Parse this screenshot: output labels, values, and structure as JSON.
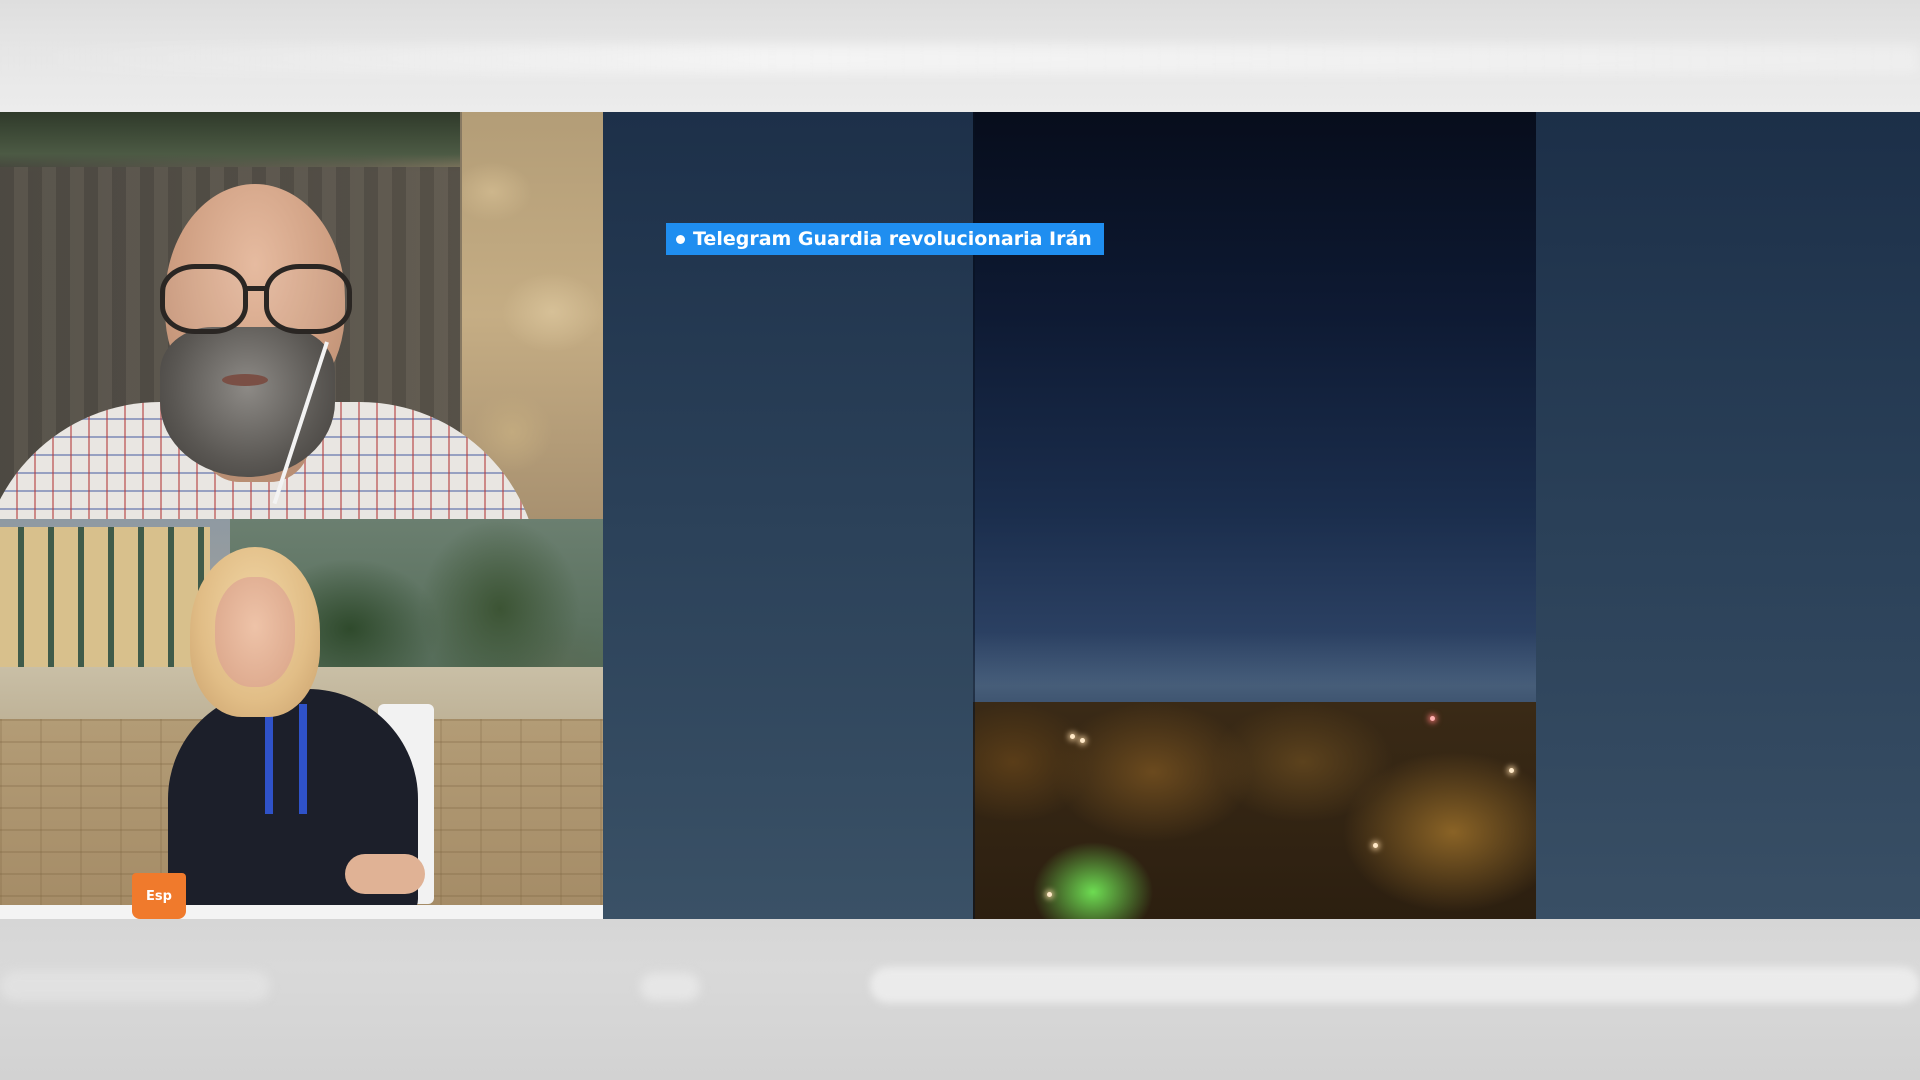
{
  "source_caption": {
    "text": "Telegram Guardia revolucionaria Irán",
    "color": "#1f8ef0"
  },
  "studio": {
    "mug_label": "Esp"
  },
  "colors": {
    "frame_background": "#dcdcdc",
    "presenter_accent": "#2f52c8",
    "mug": "#f07a2c"
  },
  "icons": {
    "caption_bullet": "live-dot-icon"
  }
}
